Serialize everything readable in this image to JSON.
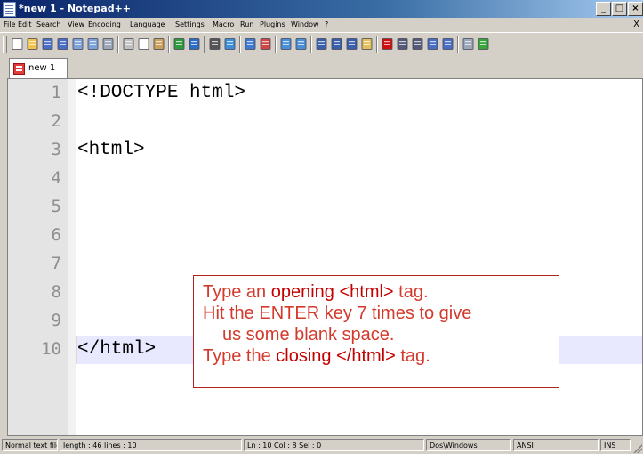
{
  "window": {
    "title": "*new  1 - Notepad++"
  },
  "menu": {
    "items": [
      "File",
      "Edit",
      "Search",
      "View",
      "Encoding",
      "Language",
      "Settings",
      "Macro",
      "Run",
      "Plugins",
      "Window",
      "?"
    ],
    "close_label": "X"
  },
  "toolbar": {
    "icons": [
      "new-file-icon",
      "open-file-icon",
      "save-icon",
      "save-all-icon",
      "close-icon",
      "close-all-icon",
      "print-icon",
      "cut-icon",
      "copy-icon",
      "paste-icon",
      "undo-icon",
      "redo-icon",
      "find-icon",
      "replace-icon",
      "zoom-in-icon",
      "zoom-out-icon",
      "sync-vertical-icon",
      "sync-horizontal-icon",
      "word-wrap-icon",
      "show-all-chars-icon",
      "indent-guide-icon",
      "doc-map-icon",
      "record-macro-icon",
      "stop-macro-icon",
      "play-macro-icon",
      "run-macro-multiple-icon",
      "save-macro-icon",
      "spellcheck-icon",
      "abc-icon"
    ]
  },
  "tabs": [
    {
      "label": "new 1"
    }
  ],
  "editor": {
    "lines": [
      {
        "num": "1",
        "text": "<!DOCTYPE html>"
      },
      {
        "num": "2",
        "text": ""
      },
      {
        "num": "3",
        "text": "<html>"
      },
      {
        "num": "4",
        "text": ""
      },
      {
        "num": "5",
        "text": ""
      },
      {
        "num": "6",
        "text": ""
      },
      {
        "num": "7",
        "text": ""
      },
      {
        "num": "8",
        "text": ""
      },
      {
        "num": "9",
        "text": ""
      },
      {
        "num": "10",
        "text": "</html>"
      }
    ],
    "current_line": 10
  },
  "callout": {
    "line1_pre": "Type an ",
    "line1_em": "opening <html>",
    "line1_post": " tag.",
    "line2": "Hit the ENTER key 7 times to give",
    "line3": "us some blank space.",
    "line4_pre": "Type the ",
    "line4_em": "closing </html>",
    "line4_post": " tag."
  },
  "status": {
    "file_type": "Normal text file",
    "length_lines": "length : 46    lines : 10",
    "position": "Ln : 10    Col : 8    Sel : 0",
    "eol": "Dos\\Windows",
    "encoding": "ANSI",
    "mode": "INS"
  },
  "colors": {
    "callout_text": "#d33a2c",
    "current_line": "#e8e8ff",
    "title_bar": "#0a246a"
  }
}
